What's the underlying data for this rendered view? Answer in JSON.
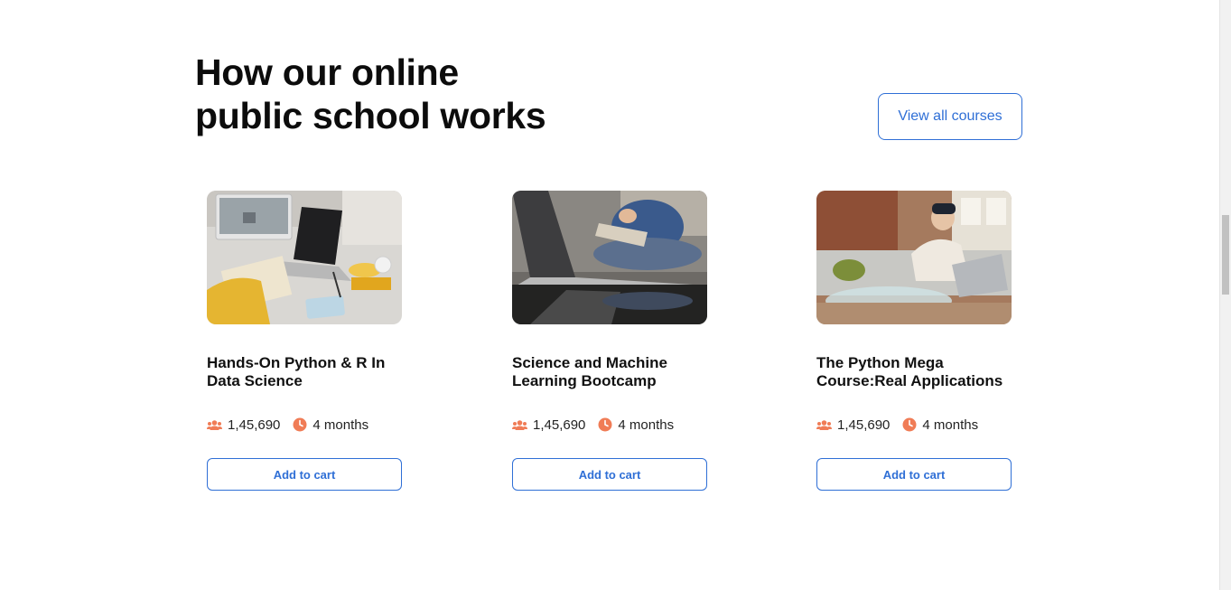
{
  "section": {
    "heading_line1": "How our online",
    "heading_line2": "public school works",
    "view_all_label": "View all courses"
  },
  "colors": {
    "accent": "#2f6fd6",
    "meta_icon": "#f07c56"
  },
  "courses": [
    {
      "title": "Hands-On Python & R In Data Science",
      "students": "1,45,690",
      "duration": "4 months",
      "cart_label": "Add to cart",
      "image": "person-studying-laptop-desk"
    },
    {
      "title": "Science and Machine Learning Bootcamp",
      "students": "1,45,690",
      "duration": "4 months",
      "cart_label": "Add to cart",
      "image": "laptop-reflection-reading"
    },
    {
      "title": "The Python Mega Course:Real Applications",
      "students": "1,45,690",
      "duration": "4 months",
      "cart_label": "Add to cart",
      "image": "man-working-laptop-sofa"
    }
  ]
}
